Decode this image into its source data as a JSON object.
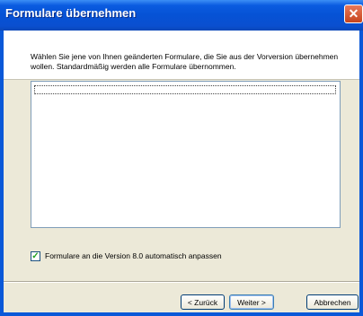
{
  "window": {
    "title": "Formulare übernehmen",
    "close_glyph": "✕"
  },
  "description": "Wählen Sie jene von Ihnen geänderten Formulare, die Sie aus der Vorversion übernehmen wollen. Standardmäßig werden alle Formulare übernommen.",
  "list": {
    "items": []
  },
  "option": {
    "checked": true,
    "check_glyph": "✓",
    "label": "Formulare an die Version 8.0 automatisch anpassen"
  },
  "buttons": {
    "back": "< Zurück",
    "next": "Weiter >",
    "cancel": "Abbrechen"
  }
}
